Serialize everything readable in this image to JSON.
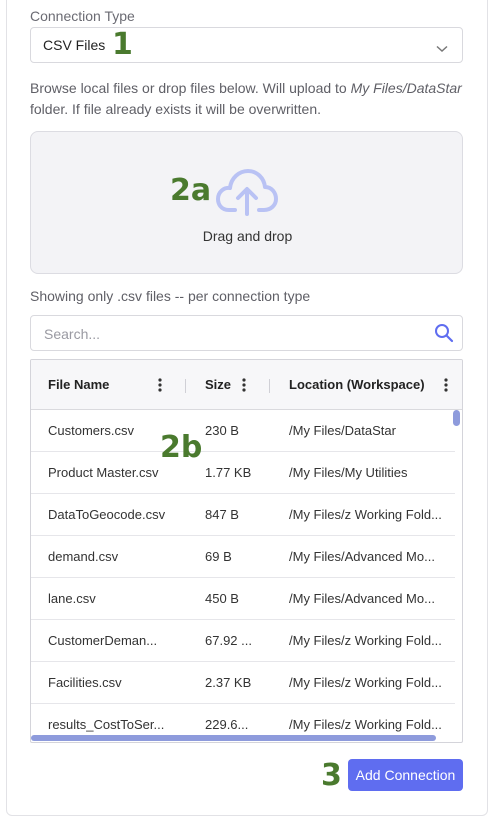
{
  "connection": {
    "label": "Connection Type",
    "value": "CSV Files"
  },
  "annotations": {
    "a1": "1",
    "a2a": "2a",
    "a2b": "2b",
    "a3": "3"
  },
  "browse": {
    "text_before": "Browse local files or drop files below. Will upload to ",
    "path": "My Files/DataStar",
    "text_after": " folder. If file already exists it will be overwritten."
  },
  "dropzone": {
    "label": "Drag and drop",
    "icon": "cloud-upload-icon"
  },
  "filter_note": "Showing only .csv files -- per connection type",
  "search": {
    "placeholder": "Search...",
    "value": "",
    "icon": "search-icon"
  },
  "grid": {
    "columns": [
      "File Name",
      "Size",
      "Location (Workspace)"
    ],
    "rows": [
      [
        "Customers.csv",
        "230 B",
        "/My Files/DataStar"
      ],
      [
        "Product Master.csv",
        "1.77 KB",
        "/My Files/My Utilities"
      ],
      [
        "DataToGeocode.csv",
        "847 B",
        "/My Files/z Working Fold..."
      ],
      [
        "demand.csv",
        "69 B",
        "/My Files/Advanced Mo..."
      ],
      [
        "lane.csv",
        "450 B",
        "/My Files/Advanced Mo..."
      ],
      [
        "CustomerDeman...",
        "67.92 ...",
        "/My Files/z Working Fold..."
      ],
      [
        "Facilities.csv",
        "2.37 KB",
        "/My Files/z Working Fold..."
      ],
      [
        "results_CostToSer...",
        "229.6...",
        "/My Files/z Working Fold..."
      ]
    ]
  },
  "actions": {
    "add_connection": "Add Connection"
  },
  "colors": {
    "accent": "#5f6df0",
    "annotation": "#4a7a2e",
    "scrollbar": "#8e9bdc"
  }
}
